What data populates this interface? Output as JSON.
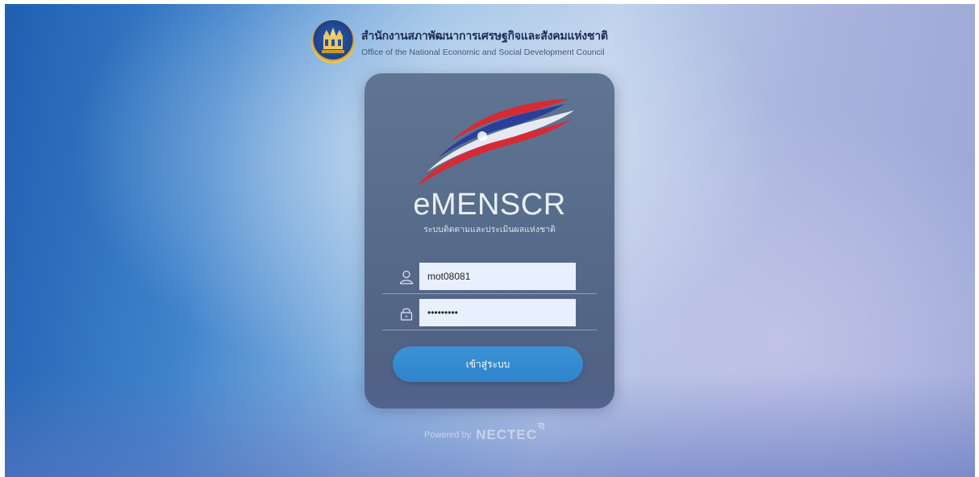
{
  "header": {
    "org_name_thai": "สำนักงานสภาพัฒนาการเศรษฐกิจและสังคมแห่งชาติ",
    "org_name_english": "Office of the National Economic and Social Development Council",
    "seal_icon": "nesdc-seal-icon"
  },
  "login_card": {
    "app_name": "eMENSCR",
    "app_subtitle": "ระบบติดตามและประเมินผลแห่งชาติ",
    "username": {
      "value": "mot08081",
      "icon": "user-icon"
    },
    "password": {
      "value": "•••••••••",
      "icon": "lock-icon"
    },
    "login_button_label": "เข้าสู่ระบบ"
  },
  "footer": {
    "powered_by": "Powered by",
    "provider": "NECTEC"
  },
  "colors": {
    "card": "#5a6e8e",
    "button": "#3589cf",
    "input_bg": "#e8f0fe",
    "flag_red": "#d62b35",
    "flag_blue": "#2a3f9a"
  }
}
